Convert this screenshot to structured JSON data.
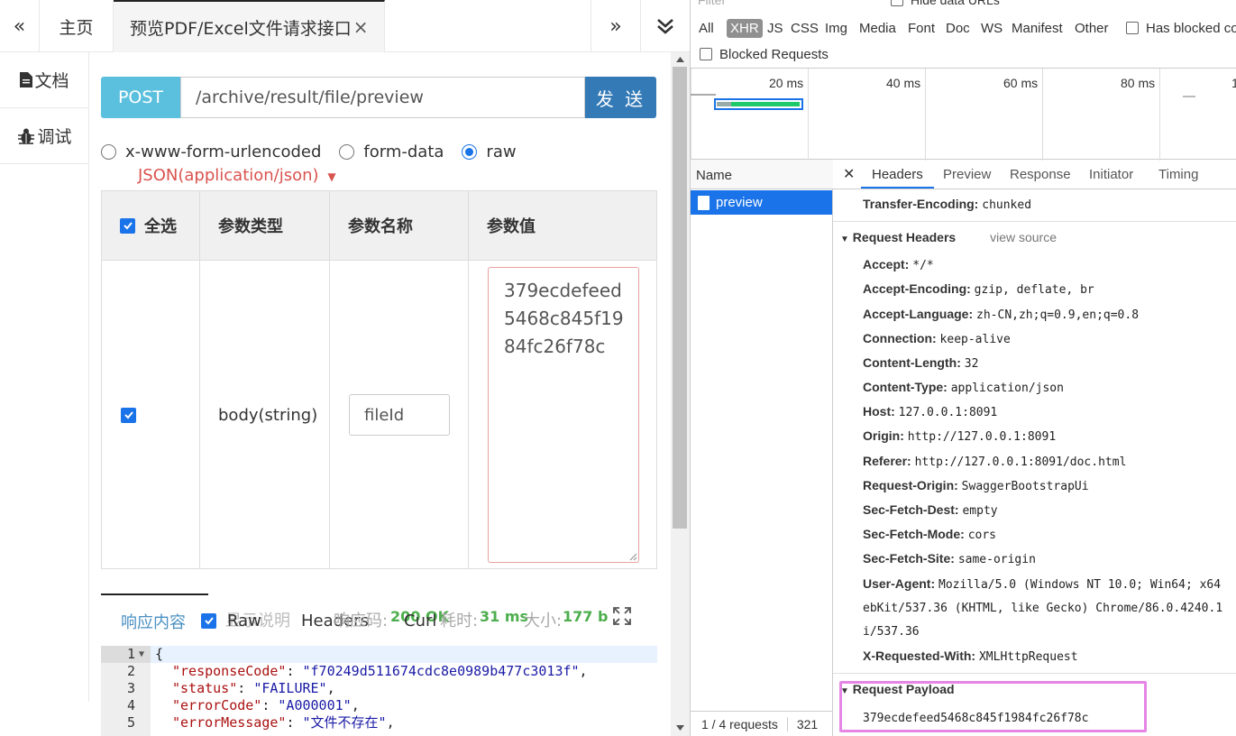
{
  "tabbar": {
    "collapse_left": "«",
    "home": "主页",
    "active_tab": "预览PDF/Excel文件请求接口",
    "close": "×",
    "more_right": "»"
  },
  "sidebar": {
    "docs": "文档",
    "debug": "调试"
  },
  "request": {
    "method": "POST",
    "url": "/archive/result/file/preview",
    "send": "发 送"
  },
  "body_type": {
    "options": [
      "x-www-form-urlencoded",
      "form-data",
      "raw"
    ],
    "selected": "raw",
    "content_type": "JSON(application/json)"
  },
  "params_table": {
    "headers": {
      "select_all": "全选",
      "type": "参数类型",
      "name": "参数名称",
      "value": "参数值"
    },
    "row": {
      "type": "body(string)",
      "name": "fileId",
      "value_lines": [
        "379ecdefeed",
        "5468c845f19",
        "84fc26f78c"
      ]
    }
  },
  "response": {
    "tabs": {
      "content": "响应内容",
      "show_desc": "显示说明",
      "raw": "Raw",
      "headers": "Headers",
      "curl": "Curl"
    },
    "status_label": "响应码:",
    "status_value": "200 OK",
    "time_label": "耗时:",
    "time_value": "31 ms",
    "size_label": "大小:",
    "size_value": "177 b",
    "code_lines": [
      {
        "n": "1",
        "open": "{"
      },
      {
        "n": "2",
        "key": "\"responseCode\"",
        "val": "\"f70249d511674cdc8e0989b477c3013f\""
      },
      {
        "n": "3",
        "key": "\"status\"",
        "val": "\"FAILURE\""
      },
      {
        "n": "4",
        "key": "\"errorCode\"",
        "val": "\"A000001\""
      },
      {
        "n": "5",
        "key": "\"errorMessage\"",
        "val": "\"文件不存在\""
      }
    ]
  },
  "devtools": {
    "filter_placeholder": "Filter",
    "hide_data_urls": "Hide data URLs",
    "types": [
      "All",
      "XHR",
      "JS",
      "CSS",
      "Img",
      "Media",
      "Font",
      "Doc",
      "WS",
      "Manifest",
      "Other"
    ],
    "active_type": "XHR",
    "has_blocked": "Has blocked co",
    "blocked_requests": "Blocked Requests",
    "timeline_ticks": [
      "20 ms",
      "40 ms",
      "60 ms",
      "80 ms",
      "1"
    ],
    "name_header": "Name",
    "request_name": "preview",
    "status_requests": "1 / 4 requests",
    "status_size": "321",
    "detail_tabs": [
      "Headers",
      "Preview",
      "Response",
      "Initiator",
      "Timing"
    ],
    "transfer_encoding": {
      "k": "Transfer-Encoding:",
      "v": "chunked"
    },
    "request_headers_title": "Request Headers",
    "view_source": "view source",
    "request_headers": [
      {
        "k": "Accept:",
        "v": "*/*"
      },
      {
        "k": "Accept-Encoding:",
        "v": "gzip, deflate, br"
      },
      {
        "k": "Accept-Language:",
        "v": "zh-CN,zh;q=0.9,en;q=0.8"
      },
      {
        "k": "Connection:",
        "v": "keep-alive"
      },
      {
        "k": "Content-Length:",
        "v": "32"
      },
      {
        "k": "Content-Type:",
        "v": "application/json"
      },
      {
        "k": "Host:",
        "v": "127.0.0.1:8091"
      },
      {
        "k": "Origin:",
        "v": "http://127.0.0.1:8091"
      },
      {
        "k": "Referer:",
        "v": "http://127.0.0.1:8091/doc.html"
      },
      {
        "k": "Request-Origin:",
        "v": "SwaggerBootstrapUi"
      },
      {
        "k": "Sec-Fetch-Dest:",
        "v": "empty"
      },
      {
        "k": "Sec-Fetch-Mode:",
        "v": "cors"
      },
      {
        "k": "Sec-Fetch-Site:",
        "v": "same-origin"
      },
      {
        "k": "User-Agent:",
        "v": "Mozilla/5.0 (Windows NT 10.0; Win64; x64"
      }
    ],
    "user_agent_cont": [
      "ebKit/537.36 (KHTML, like Gecko) Chrome/86.0.4240.1",
      "i/537.36"
    ],
    "x_requested_with": {
      "k": "X-Requested-With:",
      "v": "XMLHttpRequest"
    },
    "payload_title": "Request Payload",
    "payload_value": "379ecdefeed5468c845f1984fc26f78c"
  },
  "colors": {
    "post": "#5bc0de",
    "send": "#337ab7",
    "accent": "#1a73e8",
    "highlight": "#e586e5"
  }
}
